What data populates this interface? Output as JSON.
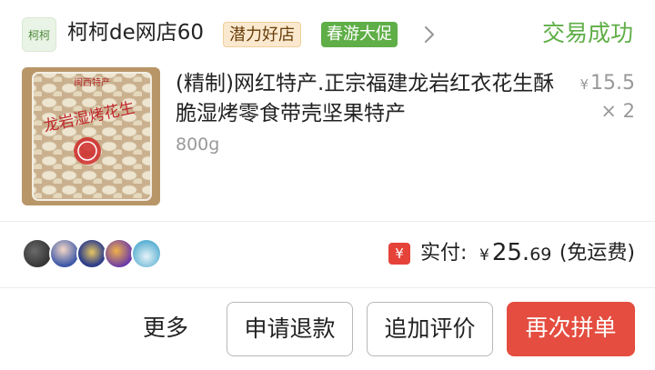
{
  "shop": {
    "avatar_text": "柯柯",
    "name": "柯柯de网店60",
    "badges": [
      "潜力好店",
      "春游大促"
    ],
    "status": "交易成功"
  },
  "product": {
    "image_label": "闽西特产",
    "image_text": "龙岩湿烤花生",
    "title": "(精制)网红特产.正宗福建龙岩红衣花生酥脆湿烤零食带壳坚果特产",
    "spec": "800g",
    "price_symbol": "¥",
    "price": "15.5",
    "quantity": "× 2"
  },
  "payment": {
    "icon": "¥",
    "label": "实付:",
    "symbol": "¥",
    "amount_int": "25.",
    "amount_dec": "69",
    "note": "(免运费)"
  },
  "actions": {
    "more": "更多",
    "refund": "申请退款",
    "review": "追加评价",
    "reorder": "再次拼单"
  },
  "colors": {
    "accent_green": "#5fae47",
    "accent_red": "#e44d3f"
  }
}
